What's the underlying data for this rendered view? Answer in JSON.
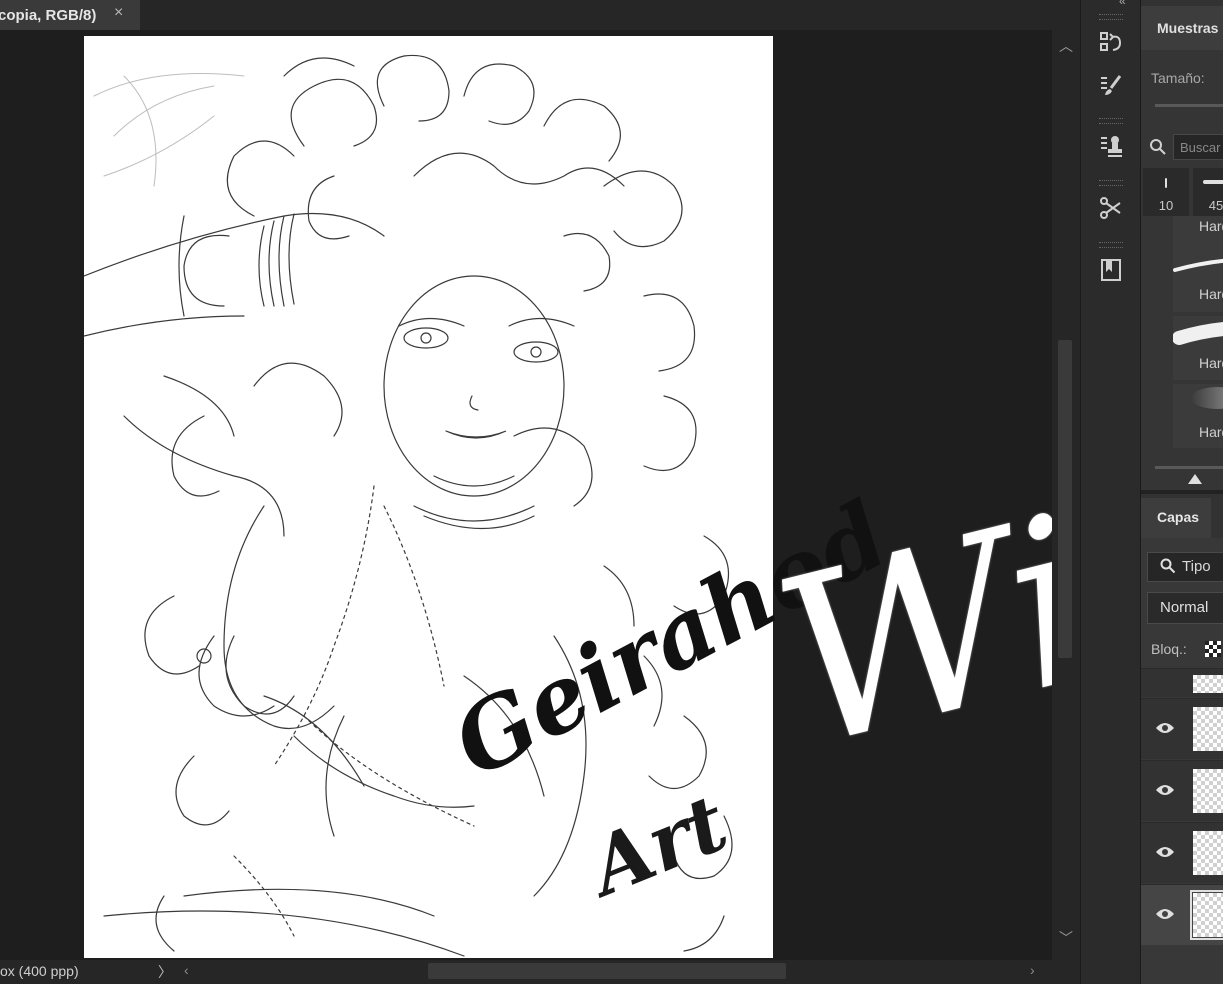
{
  "document_tab": {
    "title": "copia, RGB/8)",
    "close_glyph": "×"
  },
  "status_bar": {
    "info": "ox (400 ppp)",
    "arrow": "〉"
  },
  "canvas": {
    "watermark_name": "Geirahod",
    "watermark_sub": "Art",
    "wip_text": "WiP"
  },
  "toolstrip": {
    "items": [
      "history-icon",
      "brush-settings-icon",
      "clone-source-icon",
      "tool-presets-icon",
      "book-icon"
    ]
  },
  "brushes_panel": {
    "tab_label": "Muestras",
    "size_label": "Tamaño:",
    "search_placeholder": "Buscar",
    "preset_sizes": [
      "10",
      "45"
    ],
    "brush_names": [
      "Hard F",
      "Hard E",
      "Hard F",
      "Hard F"
    ]
  },
  "layers_panel": {
    "tab_label": "Capas",
    "filter_label": "Tipo",
    "blend_mode": "Normal",
    "lock_label": "Bloq.:"
  }
}
